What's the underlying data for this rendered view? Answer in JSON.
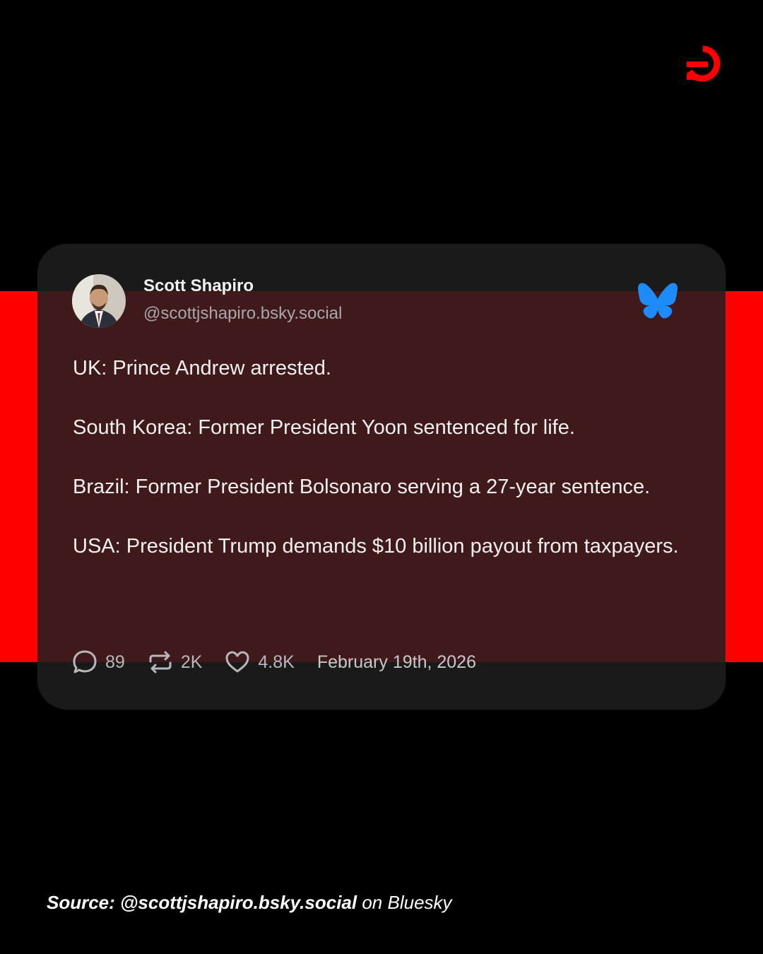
{
  "colors": {
    "accent": "#ff0000",
    "background": "#000000",
    "bluesky": "#1d8cf8"
  },
  "post": {
    "author_name": "Scott Shapiro",
    "author_handle": "@scottjshapiro.bsky.social",
    "lines": [
      "UK: Prince Andrew arrested.",
      "South Korea: Former President Yoon sentenced for life.",
      "Brazil: Former President Bolsonaro serving a 27-year sentence.",
      "USA: President Trump demands $10 billion payout from taxpayers."
    ],
    "replies": "89",
    "reposts": "2K",
    "likes": "4.8K",
    "date": "February 19th, 2026"
  },
  "icons": {
    "brand": "brand-logo-icon",
    "platform": "bluesky-butterfly-icon",
    "reply": "reply-bubble-icon",
    "repost": "repost-arrows-icon",
    "like": "heart-icon"
  },
  "footer": {
    "source_label": "Source:",
    "source_handle": "@scottjshapiro.bsky.social",
    "platform_text": "on Bluesky"
  }
}
